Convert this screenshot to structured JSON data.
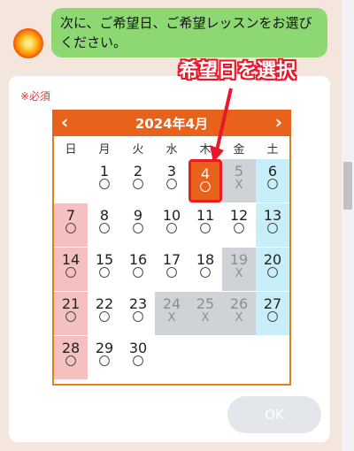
{
  "chat": {
    "message": "次に、ご希望日、ご希望レッスンをお選びください。"
  },
  "form": {
    "required_label": "※必須",
    "ok_label": "OK"
  },
  "annotation": {
    "callout": "希望日を選択"
  },
  "calendar": {
    "title": "2024年4月",
    "prev": "‹",
    "next": "›",
    "weekdays": [
      "日",
      "月",
      "火",
      "水",
      "木",
      "金",
      "土"
    ],
    "days": [
      {
        "d": "1",
        "m": "〇",
        "st": "open"
      },
      {
        "d": "2",
        "m": "〇",
        "st": "open"
      },
      {
        "d": "3",
        "m": "〇",
        "st": "open"
      },
      {
        "d": "4",
        "m": "〇",
        "st": "selected"
      },
      {
        "d": "5",
        "m": "X",
        "st": "closed"
      },
      {
        "d": "6",
        "m": "〇",
        "st": "open"
      },
      {
        "d": "7",
        "m": "〇",
        "st": "open"
      },
      {
        "d": "8",
        "m": "〇",
        "st": "open"
      },
      {
        "d": "9",
        "m": "〇",
        "st": "open"
      },
      {
        "d": "10",
        "m": "〇",
        "st": "open"
      },
      {
        "d": "11",
        "m": "〇",
        "st": "open"
      },
      {
        "d": "12",
        "m": "〇",
        "st": "open"
      },
      {
        "d": "13",
        "m": "〇",
        "st": "open"
      },
      {
        "d": "14",
        "m": "〇",
        "st": "open"
      },
      {
        "d": "15",
        "m": "〇",
        "st": "open"
      },
      {
        "d": "16",
        "m": "〇",
        "st": "open"
      },
      {
        "d": "17",
        "m": "〇",
        "st": "open"
      },
      {
        "d": "18",
        "m": "〇",
        "st": "open"
      },
      {
        "d": "19",
        "m": "X",
        "st": "closed"
      },
      {
        "d": "20",
        "m": "〇",
        "st": "open"
      },
      {
        "d": "21",
        "m": "〇",
        "st": "open"
      },
      {
        "d": "22",
        "m": "〇",
        "st": "open"
      },
      {
        "d": "23",
        "m": "〇",
        "st": "open"
      },
      {
        "d": "24",
        "m": "X",
        "st": "closed"
      },
      {
        "d": "25",
        "m": "X",
        "st": "closed"
      },
      {
        "d": "26",
        "m": "X",
        "st": "closed"
      },
      {
        "d": "27",
        "m": "〇",
        "st": "open"
      },
      {
        "d": "28",
        "m": "〇",
        "st": "open"
      },
      {
        "d": "29",
        "m": "〇",
        "st": "open"
      },
      {
        "d": "30",
        "m": "〇",
        "st": "open"
      }
    ],
    "first_weekday": 1
  },
  "colors": {
    "accent": "#e9621b",
    "bubble": "#8ed873",
    "sunday": "#f5c0c0",
    "saturday": "#c8eef8",
    "unavailable": "#cfd3d8",
    "highlight": "#e81d1d"
  }
}
